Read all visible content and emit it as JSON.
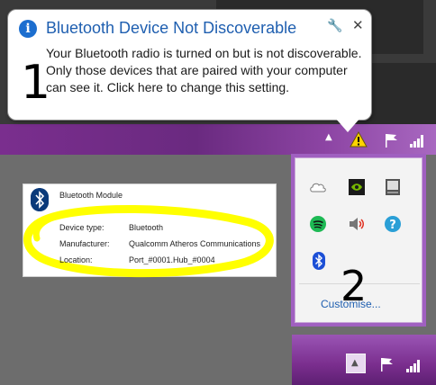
{
  "balloon": {
    "title": "Bluetooth Device Not Discoverable",
    "body": "Your Bluetooth radio is turned on but is not discoverable.  Only those devices that are paired with your computer can see it.  Click here to change this setting.",
    "annotation": "1",
    "title_color": "#1f5fb0"
  },
  "bt_card": {
    "title": "Bluetooth Module",
    "rows": [
      {
        "label": "Device type:",
        "value": "Bluetooth"
      },
      {
        "label": "Manufacturer:",
        "value": "Qualcomm Atheros Communications"
      },
      {
        "label": "Location:",
        "value": "Port_#0001.Hub_#0004"
      }
    ],
    "highlight_color": "#ffff00"
  },
  "flyout": {
    "icons": [
      "onedrive-icon",
      "nvidia-icon",
      "removable-drive-icon",
      "spotify-icon",
      "volume-icon",
      "help-icon",
      "bluetooth-icon"
    ],
    "customise_label": "Customise...",
    "annotation": "2"
  },
  "colors": {
    "taskbar": "#7a2e8e",
    "flyout_border": "#a060c0",
    "warning": "#ffd400"
  }
}
